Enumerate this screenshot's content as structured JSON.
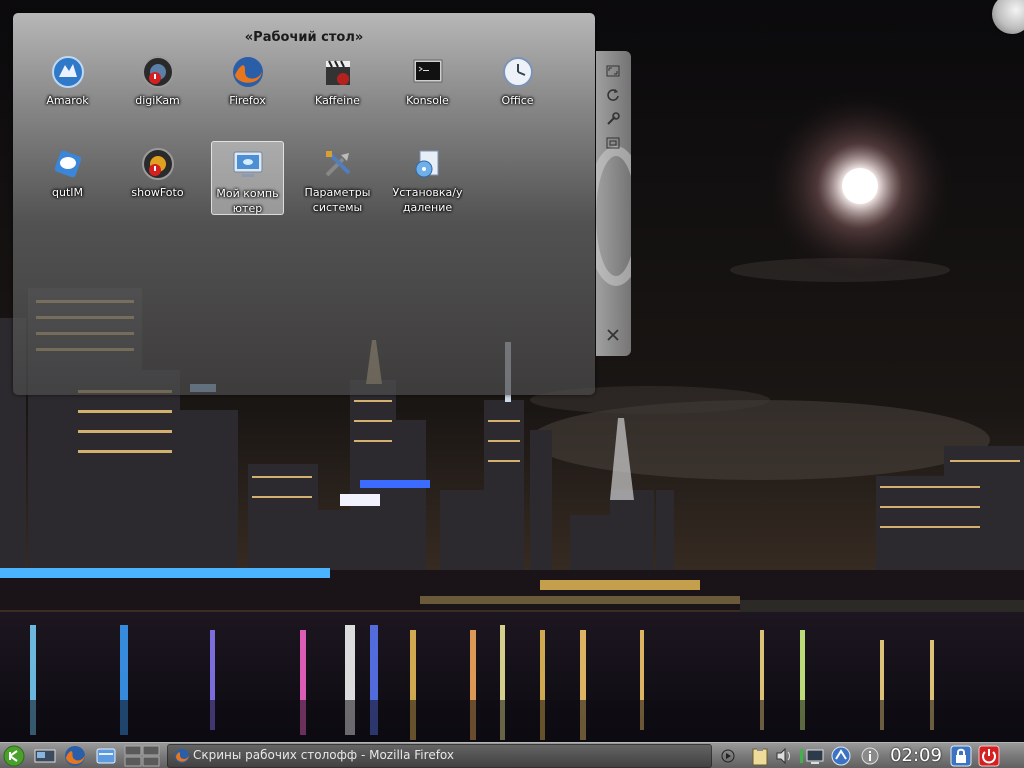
{
  "desktop": {
    "title": "«Рабочий стол»",
    "icons": [
      {
        "label": "Amarok",
        "icon": "amarok-wolf-icon"
      },
      {
        "label": "digiKam",
        "icon": "digikam-lens-icon"
      },
      {
        "label": "Firefox",
        "icon": "firefox-icon"
      },
      {
        "label": "Kaffeine",
        "icon": "kaffeine-clapper-icon"
      },
      {
        "label": "Konsole",
        "icon": "konsole-terminal-icon"
      },
      {
        "label": "Office",
        "icon": "office-clock-icon"
      },
      {
        "label": "qutIM",
        "icon": "qutim-chat-icon"
      },
      {
        "label": "showFoto",
        "icon": "showfoto-lens-icon"
      },
      {
        "label": "Мой компьютер",
        "icon": "computer-monitor-icon"
      },
      {
        "label": "Параметры системы",
        "icon": "system-settings-tools-icon"
      },
      {
        "label": "Установка/удаление",
        "icon": "install-remove-icon"
      }
    ],
    "selected_index": 8
  },
  "applet_handle": {
    "buttons": [
      "resize-icon",
      "rotate-icon",
      "configure-wrench-icon",
      "zoom-frame-icon",
      "close-icon"
    ]
  },
  "taskbar": {
    "launcher_icon": "kickoff-menu-icon",
    "quick_launch": [
      "show-desktop-icon",
      "firefox-icon",
      "file-manager-icon"
    ],
    "pager": "virtual-desktop-pager",
    "task": {
      "label": "Скрины рабочих столофф - Mozilla Firefox",
      "icon": "firefox-icon"
    },
    "tray": [
      "expand-arrow-icon",
      "clipboard-icon",
      "volume-speaker-icon",
      "network-icon",
      "updater-icon",
      "info-icon"
    ],
    "clock": "02:09",
    "lock_icon": "lock-screen-icon",
    "shutdown_icon": "shutdown-power-icon"
  },
  "colors": {
    "panel": "#7a7a7a",
    "selection": "#f5f5f5",
    "launcher_green": "#4aa02c",
    "shutdown_red": "#d42020"
  }
}
